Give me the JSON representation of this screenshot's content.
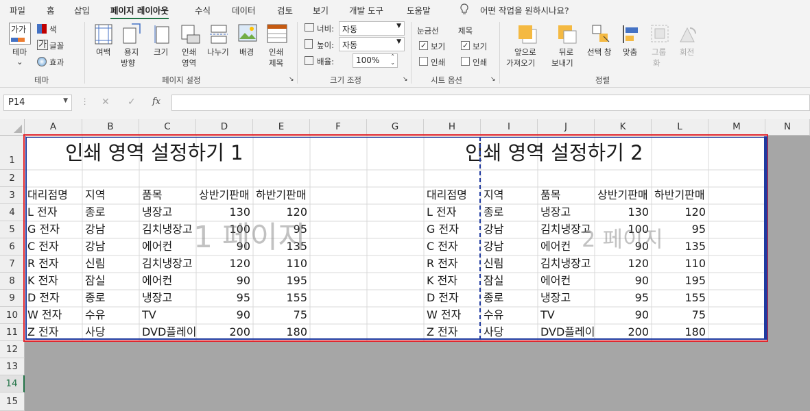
{
  "tabs": [
    "파일",
    "홈",
    "삽입",
    "페이지 레이아웃",
    "수식",
    "데이터",
    "검토",
    "보기",
    "개발 도구",
    "도움말"
  ],
  "tell_me": "어떤 작업을 원하시나요?",
  "ribbon": {
    "theme": {
      "theme_label": "테마",
      "color_label": "색",
      "font_label": "글꼴",
      "effect_label": "효과",
      "group": "테마"
    },
    "page_setup": {
      "margins": "여백",
      "orientation_1": "용지",
      "orientation_2": "방향",
      "size": "크기",
      "print_area_1": "인쇄",
      "print_area_2": "영역",
      "breaks": "나누기",
      "background": "배경",
      "print_titles_1": "인쇄",
      "print_titles_2": "제목",
      "group": "페이지 설정"
    },
    "scale": {
      "width_label": "너비:",
      "width_value": "자동",
      "height_label": "높이:",
      "height_value": "자동",
      "scale_label": "배율:",
      "scale_value": "100%",
      "group": "크기 조정"
    },
    "sheet_options": {
      "gridlines": "눈금선",
      "headings": "제목",
      "view": "보기",
      "print": "인쇄",
      "group": "시트 옵션"
    },
    "arrange": {
      "bring_forward_1": "앞으로",
      "bring_forward_2": "가져오기",
      "send_backward_1": "뒤로",
      "send_backward_2": "보내기",
      "selection_pane": "선택 창",
      "align": "맞춤",
      "group_label_1": "그룹",
      "group_label_2": "화",
      "rotate": "회전",
      "group": "정렬"
    }
  },
  "formula_bar": {
    "name_box": "P14",
    "fx": "fx",
    "cancel": "✕",
    "enter": "✓"
  },
  "columns": [
    "A",
    "B",
    "C",
    "D",
    "E",
    "F",
    "G",
    "H",
    "I",
    "J",
    "K",
    "L",
    "M",
    "N"
  ],
  "rows": [
    "1",
    "2",
    "3",
    "4",
    "5",
    "6",
    "7",
    "8",
    "9",
    "10",
    "11",
    "12",
    "13",
    "14",
    "15"
  ],
  "sheet": {
    "title1": "인쇄 영역 설정하기 1",
    "title2": "인쇄 영역 설정하기 2",
    "headers": [
      "대리점명",
      "지역",
      "품목",
      "상반기판매",
      "하반기판매"
    ],
    "data": [
      [
        "L 전자",
        "종로",
        "냉장고",
        "130",
        "120"
      ],
      [
        "G 전자",
        "강남",
        "김치냉장고",
        "100",
        "95"
      ],
      [
        "C 전자",
        "강남",
        "에어컨",
        "90",
        "135"
      ],
      [
        "R 전자",
        "신림",
        "김치냉장고",
        "120",
        "110"
      ],
      [
        "K 전자",
        "잠실",
        "에어컨",
        "90",
        "195"
      ],
      [
        "D 전자",
        "종로",
        "냉장고",
        "95",
        "155"
      ],
      [
        "W 전자",
        "수유",
        "TV",
        "90",
        "75"
      ],
      [
        "Z 전자",
        "사당",
        "DVD플레이어",
        "200",
        "180"
      ]
    ],
    "page1_watermark": "1 페이지",
    "page2_watermark": "2 페이지"
  },
  "colors": {
    "accent": "#217346",
    "print_border": "#e0242b",
    "page_break": "#1f3aa0"
  }
}
